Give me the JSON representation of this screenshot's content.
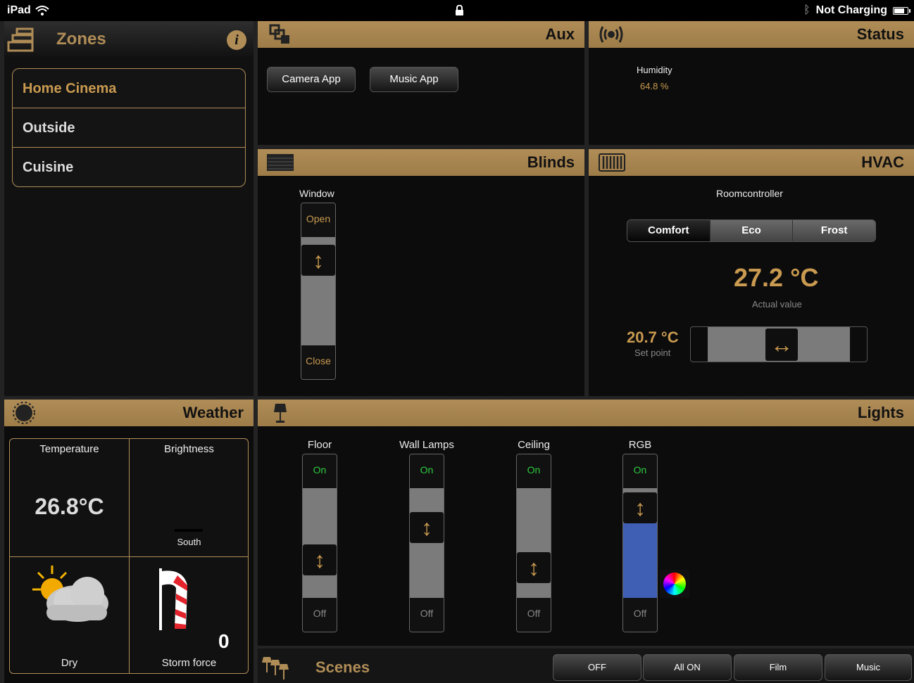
{
  "status_bar": {
    "device": "iPad",
    "charging": "Not Charging"
  },
  "zones": {
    "title": "Zones",
    "info": "i",
    "items": [
      {
        "label": "Home Cinema",
        "active": true
      },
      {
        "label": "Outside"
      },
      {
        "label": "Cuisine"
      }
    ]
  },
  "aux": {
    "title": "Aux",
    "buttons": [
      "Camera App",
      "Music App"
    ]
  },
  "status": {
    "title": "Status",
    "humidity_label": "Humidity",
    "humidity_value": "64.8 %"
  },
  "blinds": {
    "title": "Blinds",
    "window_label": "Window",
    "open_label": "Open",
    "close_label": "Close",
    "position": 0.1
  },
  "hvac": {
    "title": "HVAC",
    "room_label": "Roomcontroller",
    "modes": [
      "Comfort",
      "Eco",
      "Frost"
    ],
    "active_mode": "Comfort",
    "actual_value": "27.2 °C",
    "actual_label": "Actual value",
    "setpoint_value": "20.7 °C",
    "setpoint_label": "Set point",
    "setpoint_fraction": 0.52
  },
  "weather": {
    "title": "Weather",
    "temperature_label": "Temperature",
    "temperature_value": "26.8°C",
    "brightness_label": "Brightness",
    "brightness_direction": "South",
    "rain_label": "Dry",
    "wind_label": "Storm force",
    "wind_value": "0"
  },
  "lights": {
    "title": "Lights",
    "on_label": "On",
    "off_label": "Off",
    "channels": [
      {
        "label": "Floor",
        "level": 0.3
      },
      {
        "label": "Wall Lamps",
        "level": 0.7
      },
      {
        "label": "Ceiling",
        "level": 0.2
      },
      {
        "label": "RGB",
        "level": 0.95,
        "color": "#3f5fb5"
      }
    ]
  },
  "scenes": {
    "title": "Scenes",
    "buttons": [
      "OFF",
      "All ON",
      "Film",
      "Music"
    ]
  },
  "colors": {
    "accent": "#b08d57",
    "on_green": "#2ecc40",
    "rgb_fill": "#3f5fb5"
  }
}
